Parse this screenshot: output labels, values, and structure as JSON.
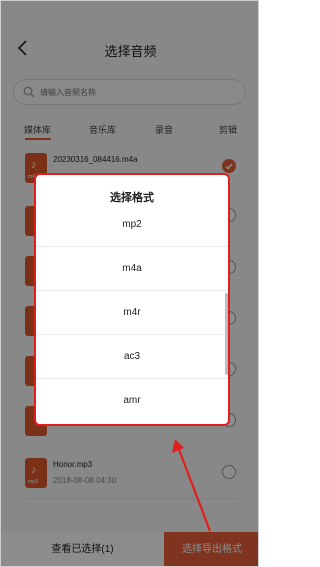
{
  "header": {
    "title": "选择音频"
  },
  "search": {
    "placeholder": "请输入音频名称"
  },
  "tabs": [
    {
      "label": "媒体库",
      "active": true
    },
    {
      "label": "音乐库",
      "active": false
    },
    {
      "label": "录音",
      "active": false
    },
    {
      "label": "剪辑",
      "active": false
    }
  ],
  "files": [
    {
      "name": "20230316_084416.m4a",
      "meta": "",
      "ext": "m4a",
      "checked": true
    },
    {
      "name": "Honor.mp3",
      "meta": "2018-08-08   04:30",
      "ext": "mp3",
      "checked": false
    }
  ],
  "bottom": {
    "view_selected": "查看已选择(1)",
    "export_label": "选择导出格式"
  },
  "dialog": {
    "title": "选择格式",
    "options": [
      "mp2",
      "m4a",
      "m4r",
      "ac3",
      "amr"
    ]
  },
  "colors": {
    "accent": "#e8603a",
    "highlight": "#e0201e"
  }
}
